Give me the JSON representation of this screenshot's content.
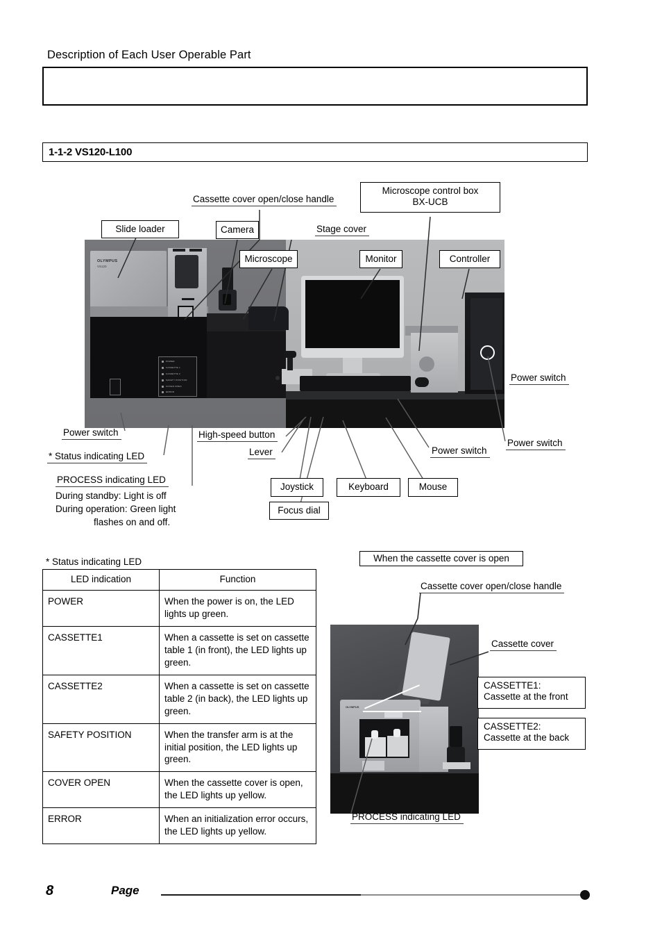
{
  "header": {
    "title": "Description of Each User Operable Part",
    "note_box_text": ""
  },
  "section": {
    "number_and_title": "1-1-2 VS120-L100"
  },
  "main_diagram": {
    "callouts": [
      {
        "id": "cassette-cover-handle",
        "label": "Cassette cover open/close handle",
        "style": "underline"
      },
      {
        "id": "microscope-control-box",
        "label": "Microscope control box\nBX-UCB",
        "style": "box"
      },
      {
        "id": "slide-loader",
        "label": "Slide loader",
        "style": "box"
      },
      {
        "id": "camera",
        "label": "Camera",
        "style": "box"
      },
      {
        "id": "stage-cover",
        "label": "Stage cover",
        "style": "underline"
      },
      {
        "id": "microscope",
        "label": "Microscope",
        "style": "box"
      },
      {
        "id": "monitor",
        "label": "Monitor",
        "style": "box"
      },
      {
        "id": "controller",
        "label": "Controller",
        "style": "box"
      },
      {
        "id": "power-switch-controller",
        "label": "Power switch",
        "style": "underline"
      },
      {
        "id": "power-switch-loader",
        "label": "Power switch",
        "style": "underline"
      },
      {
        "id": "status-indicating-led",
        "label": "* Status indicating LED",
        "style": "underline"
      },
      {
        "id": "process-indicating-led",
        "label": "PROCESS indicating LED",
        "style": "underline"
      },
      {
        "id": "high-speed-button",
        "label": "High-speed button",
        "style": "underline"
      },
      {
        "id": "lever",
        "label": "Lever",
        "style": "underline"
      },
      {
        "id": "joystick",
        "label": "Joystick",
        "style": "box"
      },
      {
        "id": "focus-dial",
        "label": "Focus dial",
        "style": "box"
      },
      {
        "id": "keyboard",
        "label": "Keyboard",
        "style": "box"
      },
      {
        "id": "mouse",
        "label": "Mouse",
        "style": "box"
      },
      {
        "id": "power-switch-bxucb",
        "label": "Power switch",
        "style": "underline"
      },
      {
        "id": "power-switch-tower",
        "label": "Power switch",
        "style": "underline"
      }
    ],
    "labels": {
      "cassette_cover_handle": "Cassette cover open/close handle",
      "microscope_control_box_line1": "Microscope control box",
      "microscope_control_box_line2": "BX-UCB",
      "slide_loader": "Slide loader",
      "camera": "Camera",
      "stage_cover": "Stage cover",
      "microscope": "Microscope",
      "monitor": "Monitor",
      "controller": "Controller",
      "power_switch": "Power switch",
      "status_indicating_led": "* Status indicating LED",
      "process_indicating_led": "PROCESS indicating LED",
      "high_speed_button": "High-speed button",
      "lever": "Lever",
      "joystick": "Joystick",
      "focus_dial": "Focus dial",
      "keyboard": "Keyboard",
      "mouse": "Mouse"
    },
    "process_led_note": {
      "line1": "During standby: Light is off",
      "line2": "During operation: Green light",
      "line3": "flashes on and off."
    },
    "device_led_panel": [
      "POWER",
      "CASSETTE 1",
      "CASSETTE 2",
      "SAFETY POSITION",
      "COVER OPEN",
      "ERROR"
    ],
    "device_brand": "OLYMPUS",
    "device_model": "VS120"
  },
  "led_table": {
    "caption": "* Status indicating LED",
    "columns": [
      "LED indication",
      "Function"
    ],
    "rows": [
      {
        "indication": "POWER",
        "function": "When the power is on, the LED lights up green."
      },
      {
        "indication": "CASSETTE1",
        "function": "When a cassette is set on cassette table 1 (in front), the LED lights up green."
      },
      {
        "indication": "CASSETTE2",
        "function": "When a cassette is set on cassette table 2 (in back), the LED lights up green."
      },
      {
        "indication": "SAFETY POSITION",
        "function": "When the transfer arm is at the initial position, the LED lights up green."
      },
      {
        "indication": "COVER OPEN",
        "function": "When the cassette cover is open, the LED lights up yellow."
      },
      {
        "indication": "ERROR",
        "function": "When an initialization error occurs, the LED lights up yellow."
      }
    ]
  },
  "cassette_diagram": {
    "title": "When the cassette cover is open",
    "callouts": {
      "handle": "Cassette cover open/close handle",
      "cover": "Cassette cover",
      "cassette1_line1": "CASSETTE1:",
      "cassette1_line2": "Cassette at the front",
      "cassette2_line1": "CASSETTE2:",
      "cassette2_line2": "Cassette at the back",
      "process_led": "PROCESS indicating LED"
    },
    "device_brand": "OLYMPUS"
  },
  "footer": {
    "page_number": "8",
    "page_word": "Page"
  }
}
